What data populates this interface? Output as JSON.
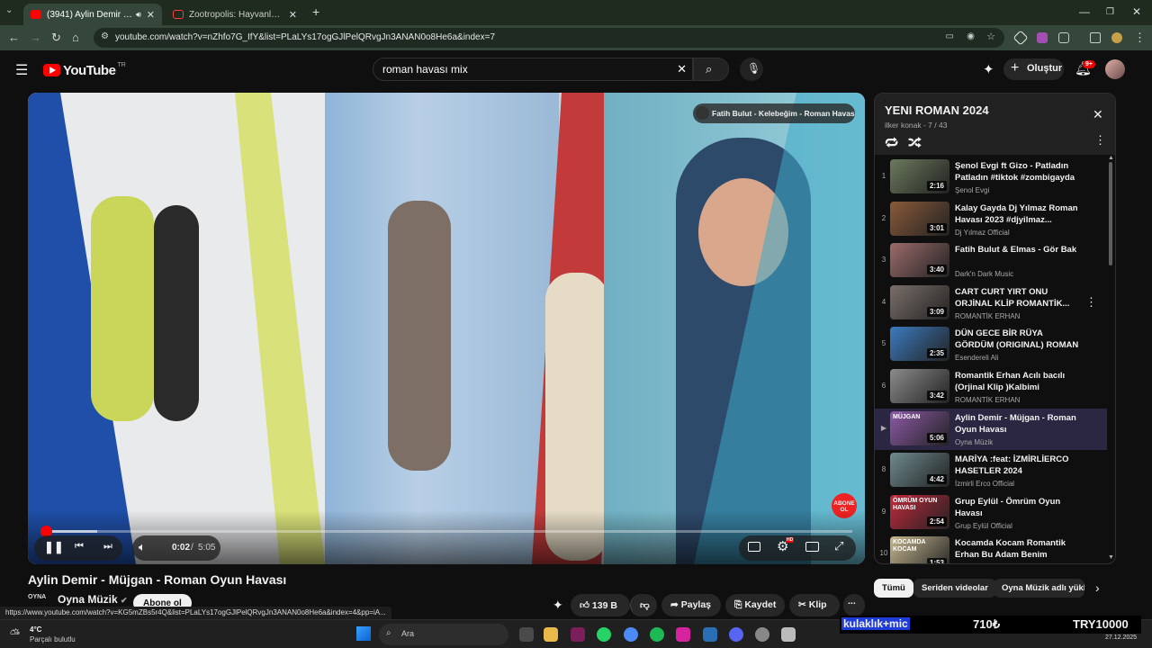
{
  "browser": {
    "tabs": [
      {
        "title": "(3941) Aylin Demir - Müjgan"
      },
      {
        "title": "Zootropolis: Hayvanlar Şehri | F"
      }
    ],
    "url": "youtube.com/watch?v=nZhfo7G_IfY&list=PLaLYs17ogGJlPelQRvgJn3ANAN0o8He6a&index=7"
  },
  "youtube": {
    "logo_text": "YouTube",
    "logo_region": "TR",
    "search_value": "roman havası mix",
    "create_label": "Oluştur",
    "notif_count": "9+"
  },
  "player": {
    "time_current": "0:02",
    "time_separator": "/",
    "time_total": "5:05",
    "progress_fraction": 0.007,
    "buffered_fraction": 0.07,
    "next_video_badge": "Fatih Bulut - Kelebeğim - Roman Havası",
    "watermark": "ABONE OL",
    "settings_badge": "HD"
  },
  "video": {
    "title": "Aylin Demir - Müjgan - Roman Oyun Havası",
    "channel": "Oyna Müzik",
    "subscribe_label": "Abone ol",
    "likes": "139 B",
    "share": "Paylaş",
    "save": "Kaydet",
    "clip": "Klip",
    "more": "..."
  },
  "status_url": "https://www.youtube.com/watch?v=KG5mZBs5r4Q&list=PLaLYs17ogGJlPelQRvgJn3ANAN0o8He6a&index=4&pp=iA...",
  "playlist": {
    "title": "YENI ROMAN 2024",
    "meta": "ilker konak - 7 / 43",
    "items": [
      {
        "index": "1",
        "title": "Şenol Evgi ft Gizo - Patladın Patladın #tiktok #zombigayda",
        "channel": "Şenol Evgi",
        "duration": "2:16",
        "color": "#6b7a5c"
      },
      {
        "index": "2",
        "title": "Kalay Gayda Dj Yılmaz Roman Havası 2023 #djyilmaz...",
        "channel": "Dj Yılmaz Official",
        "duration": "3:01",
        "color": "#8a5a3a"
      },
      {
        "index": "3",
        "title": "Fatih Bulut & Elmas - Gör Bak",
        "channel": "Dark'n Dark Music",
        "duration": "3:40",
        "color": "#9c6b6b"
      },
      {
        "index": "4",
        "title": "CART CURT YIRT ONU ORJİNAL KLİP ROMANTİK...",
        "channel": "ROMANTİK ERHAN",
        "duration": "3:09",
        "color": "#7a6f6a"
      },
      {
        "index": "5",
        "title": "DÜN GECE BİR RÜYA GÖRDÜM (ORIGINAL) ROMAN HAVASI",
        "channel": "Esendereli Ali",
        "duration": "2:35",
        "color": "#3c7bbf"
      },
      {
        "index": "6",
        "title": "Romantik Erhan Acılı bacılı (Orjinal Klip )Kalbimi yaksalar...",
        "channel": "ROMANTİK ERHAN",
        "duration": "3:42",
        "color": "#8b8b8b"
      },
      {
        "index": "",
        "title": "Aylin Demir - Müjgan - Roman Oyun Havası",
        "channel": "Oyna Müzik",
        "duration": "5:06",
        "color": "#8d5aa8",
        "thumb_label": "MÜJGAN"
      },
      {
        "index": "8",
        "title": "MARİYA :feat: İZMİRLİERCO HASETLER 2024",
        "channel": "İzmirli Erco Official",
        "duration": "4:42",
        "color": "#6e8a8e"
      },
      {
        "index": "9",
        "title": "Grup Eylül - Ömrüm Oyun Havası",
        "channel": "Grup Eylül Official",
        "duration": "2:54",
        "color": "#c2293c",
        "thumb_label": "ÖMRÜM OYUN HAVASI"
      },
      {
        "index": "10",
        "title": "Kocamda Kocam Romantik Erhan Bu Adam Benim Kocam...",
        "channel": "ROMANTİK ERHAN",
        "duration": "1:53",
        "color": "#c8b892",
        "thumb_label": "KOCAMDA KOCAM"
      }
    ]
  },
  "chips": [
    "Tümü",
    "Seriden videolar",
    "Oyna Müzik adlı yükle"
  ],
  "taskbar": {
    "temp": "4°C",
    "weather": "Parçalı bulutlu",
    "search": "Ara",
    "date": "27.12.2025",
    "ad_left": "kulaklık+mic",
    "ad_mid": "710₺",
    "ad_right": "TRY10000"
  },
  "colors": {
    "accent": "#ff0000",
    "playlist_selected": "#2b2742",
    "chrome": "#35473a"
  }
}
